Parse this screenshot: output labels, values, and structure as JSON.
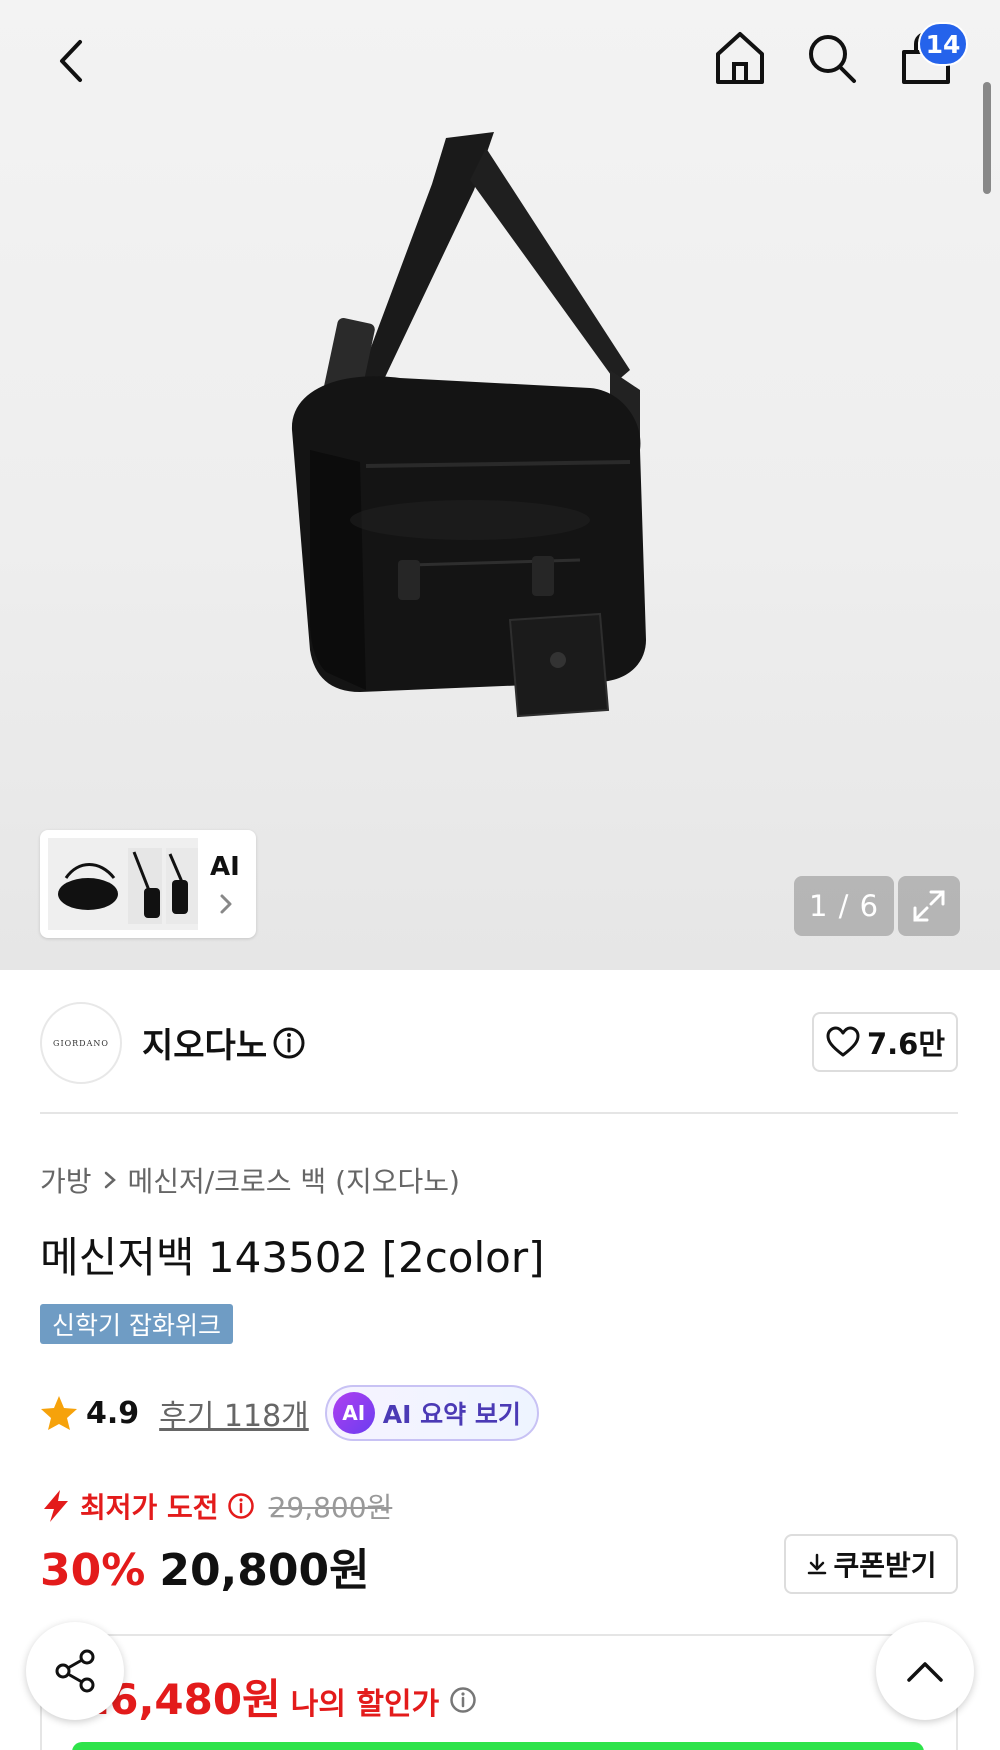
{
  "header": {
    "cart_count": "14",
    "icons": [
      "back-icon",
      "home-icon",
      "search-icon",
      "cart-icon"
    ]
  },
  "gallery": {
    "thumb_ai_label": "AI",
    "page_counter": "1 / 6"
  },
  "brand": {
    "logo_text": "GIORDANO",
    "name": "지오다노",
    "likes": "7.6만"
  },
  "product": {
    "breadcrumb": [
      "가방",
      "메신저/크로스 백 (지오다노)"
    ],
    "title": "메신저백 143502 [2color]",
    "tag": "신학기 잡화위크"
  },
  "rating": {
    "score": "4.9",
    "reviews": "후기 118개",
    "ai_badge": "AI",
    "ai_summary": "AI 요약 보기"
  },
  "price": {
    "deal_label": "최저가 도전",
    "original": "29,800원",
    "discount": "30%",
    "sale": "20,800원",
    "coupon_label": "쿠폰받기",
    "my_price": "16,480원",
    "my_price_label": "나의 할인가"
  },
  "colors": {
    "accent_red": "#e31b1b",
    "badge_blue": "#2563eb",
    "tag_blue": "#6f9cc4",
    "ai_purple": "#6a3df0",
    "cta_green": "#2ee34a"
  }
}
